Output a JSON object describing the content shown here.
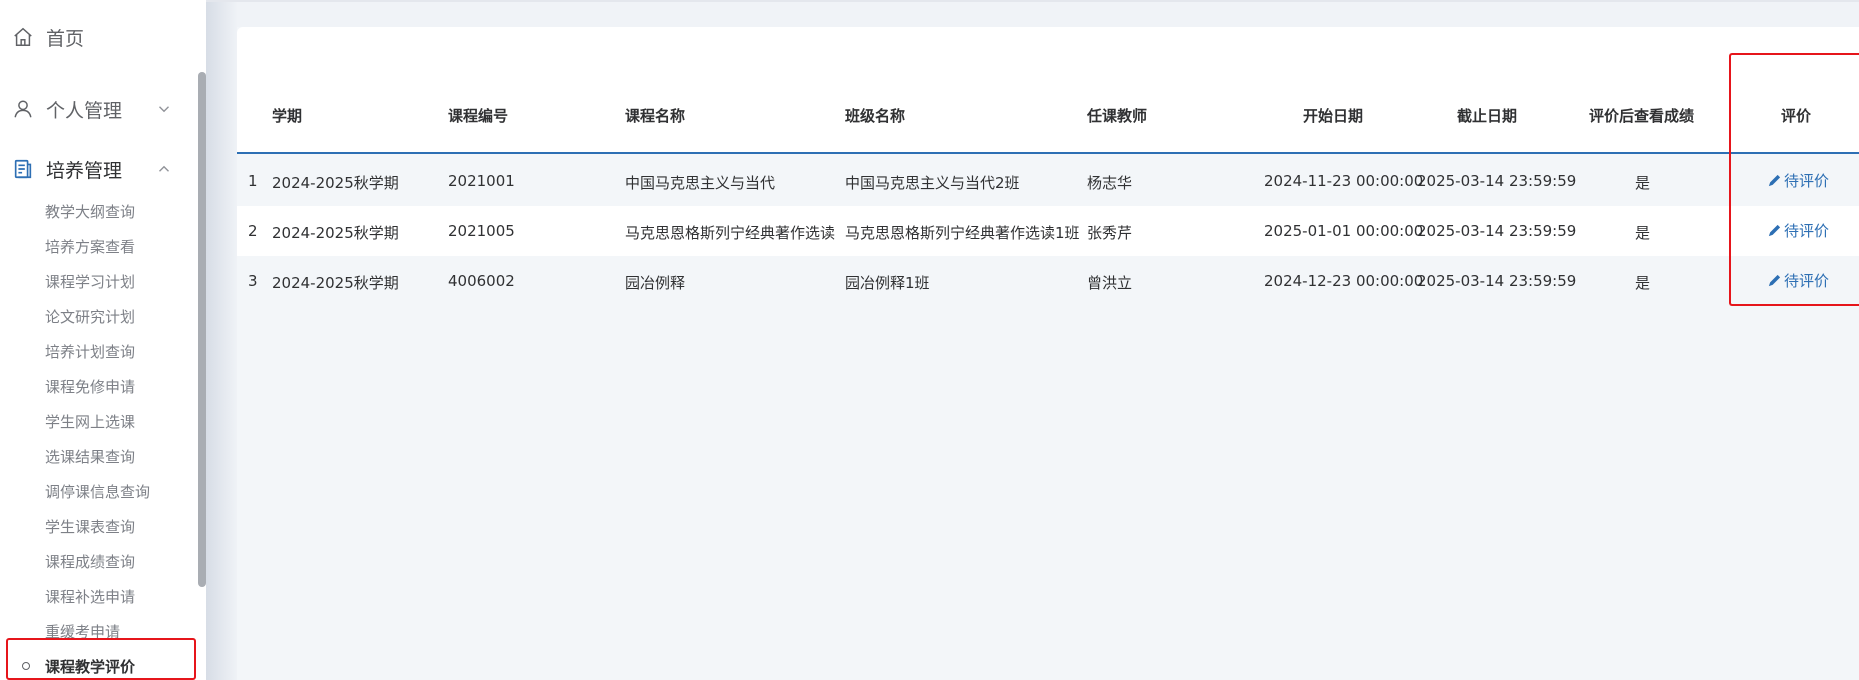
{
  "sidebar": {
    "home": {
      "label": "首页",
      "icon": "home-icon"
    },
    "personal": {
      "label": "个人管理",
      "icon": "user-icon",
      "expanded": false
    },
    "training": {
      "label": "培养管理",
      "icon": "document-icon",
      "expanded": true
    },
    "sub_items": [
      "教学大纲查询",
      "培养方案查看",
      "课程学习计划",
      "论文研究计划",
      "培养计划查询",
      "课程免修申请",
      "学生网上选课",
      "选课结果查询",
      "调停课信息查询",
      "学生课表查询",
      "课程成绩查询",
      "课程补选申请",
      "重缓考申请",
      "课程教学评价"
    ],
    "current_item": "课程教学评价"
  },
  "table": {
    "headers": {
      "term": "学期",
      "course_code": "课程编号",
      "course_name": "课程名称",
      "class_name": "班级名称",
      "teacher": "任课教师",
      "start_date": "开始日期",
      "end_date": "截止日期",
      "view_score": "评价后查看成绩",
      "evaluate": "评价"
    },
    "rows": [
      {
        "index": "1",
        "term": "2024-2025秋学期",
        "course_code": "2021001",
        "course_name": "中国马克思主义与当代",
        "class_name": "中国马克思主义与当代2班",
        "teacher": "杨志华",
        "start_date": "2024-11-23 00:00:00",
        "end_date": "2025-03-14 23:59:59",
        "view_score": "是",
        "evaluate": "待评价"
      },
      {
        "index": "2",
        "term": "2024-2025秋学期",
        "course_code": "2021005",
        "course_name": "马克思恩格斯列宁经典著作选读",
        "class_name": "马克思恩格斯列宁经典著作选读1班",
        "teacher": "张秀芹",
        "start_date": "2025-01-01 00:00:00",
        "end_date": "2025-03-14 23:59:59",
        "view_score": "是",
        "evaluate": "待评价"
      },
      {
        "index": "3",
        "term": "2024-2025秋学期",
        "course_code": "4006002",
        "course_name": "园冶例释",
        "class_name": "园冶例释1班",
        "teacher": "曾洪立",
        "start_date": "2024-12-23 00:00:00",
        "end_date": "2025-03-14 23:59:59",
        "view_score": "是",
        "evaluate": "待评价"
      }
    ]
  },
  "colors": {
    "accent": "#2d6fb4",
    "highlight": "#e6151b"
  }
}
